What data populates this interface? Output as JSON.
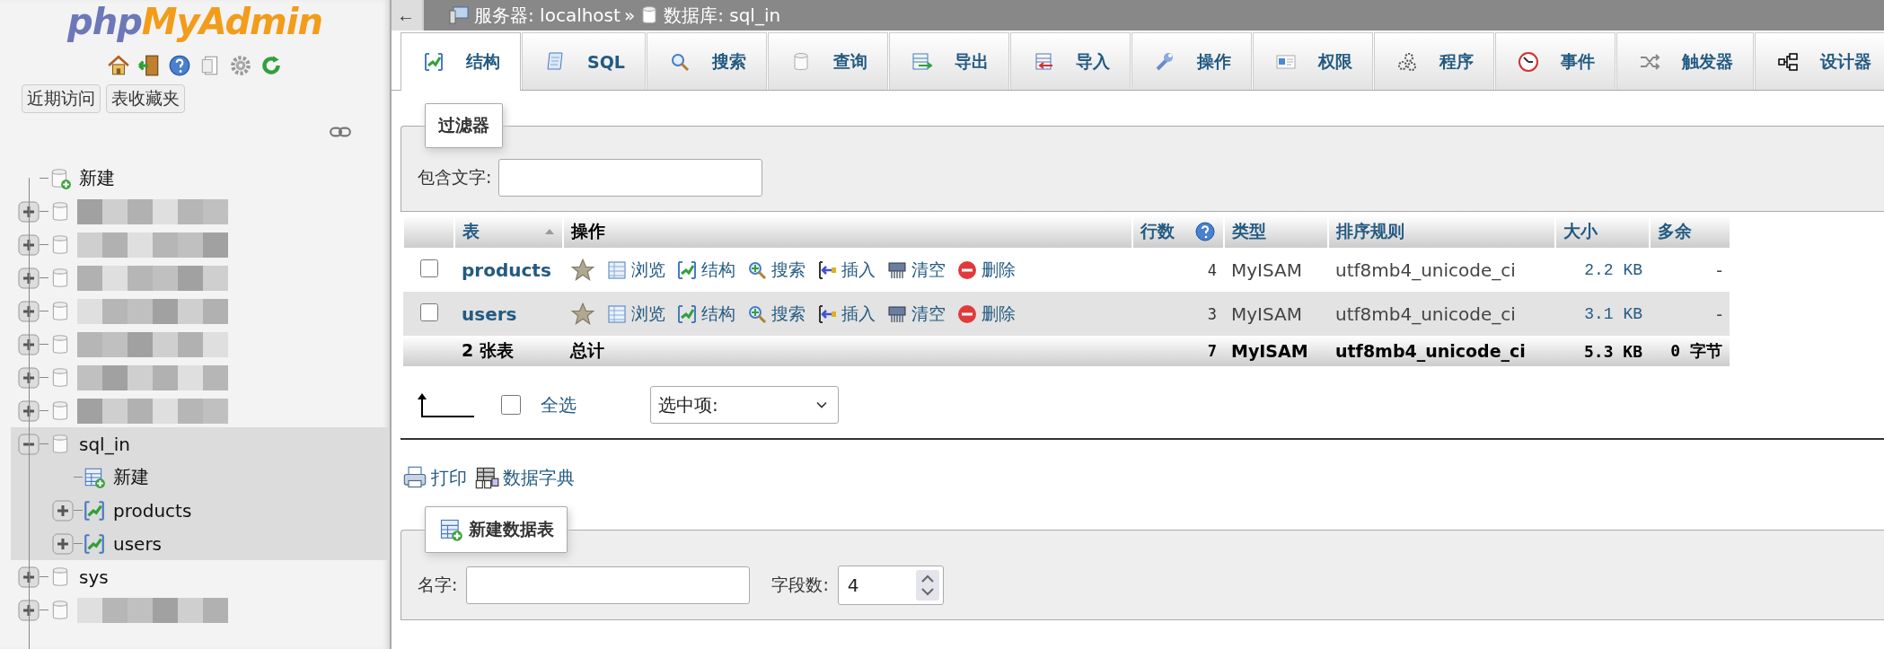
{
  "logo": {
    "part1": "php",
    "part2": "MyAdmin"
  },
  "sidebar_icons": [
    {
      "kind": "home"
    },
    {
      "kind": "exit"
    },
    {
      "kind": "help"
    },
    {
      "kind": "docs"
    },
    {
      "kind": "settings"
    },
    {
      "kind": "reload"
    }
  ],
  "sidebar_buttons": [
    "近期访问",
    "表收藏夹"
  ],
  "tree": [
    {
      "kind": "new",
      "label": "新建"
    },
    {
      "kind": "redacted",
      "expanded": false
    },
    {
      "kind": "redacted",
      "expanded": false
    },
    {
      "kind": "redacted",
      "expanded": false
    },
    {
      "kind": "redacted",
      "expanded": false
    },
    {
      "kind": "redacted",
      "expanded": false
    },
    {
      "kind": "redacted",
      "expanded": false
    },
    {
      "kind": "redacted",
      "expanded": false
    },
    {
      "kind": "database",
      "label": "sql_in",
      "expanded": true,
      "selected": true,
      "children": [
        {
          "kind": "new-table",
          "label": "新建"
        },
        {
          "kind": "table",
          "label": "products",
          "expanded": false
        },
        {
          "kind": "table",
          "label": "users",
          "expanded": false
        }
      ]
    },
    {
      "kind": "database",
      "label": "sys",
      "expanded": false,
      "selected": false
    },
    {
      "kind": "redacted",
      "expanded": false
    }
  ],
  "back_button": "←",
  "breadcrumb": {
    "server": "服务器: localhost",
    "separator": "»",
    "database": "数据库: sql_in"
  },
  "tabs": [
    {
      "kind": "structure",
      "label": "结构",
      "selected": true
    },
    {
      "kind": "sql",
      "label": "SQL",
      "selected": false
    },
    {
      "kind": "search",
      "label": "搜索",
      "selected": false
    },
    {
      "kind": "query",
      "label": "查询",
      "selected": false
    },
    {
      "kind": "export",
      "label": "导出",
      "selected": false
    },
    {
      "kind": "import",
      "label": "导入",
      "selected": false
    },
    {
      "kind": "operations",
      "label": "操作",
      "selected": false
    },
    {
      "kind": "privileges",
      "label": "权限",
      "selected": false
    },
    {
      "kind": "routines",
      "label": "程序",
      "selected": false
    },
    {
      "kind": "events",
      "label": "事件",
      "selected": false
    },
    {
      "kind": "triggers",
      "label": "触发器",
      "selected": false
    },
    {
      "kind": "designer",
      "label": "设计器",
      "selected": false
    }
  ],
  "filter": {
    "legend": "过滤器",
    "label": "包含文字:"
  },
  "table": {
    "columns": [
      {
        "label": "表",
        "kind": "link",
        "sort_ascending": true
      },
      {
        "label": "操作",
        "kind": "text"
      },
      {
        "label": "行数",
        "kind": "link",
        "help": true
      },
      {
        "label": "类型",
        "kind": "link"
      },
      {
        "label": "排序规则",
        "kind": "link"
      },
      {
        "label": "大小",
        "kind": "link"
      },
      {
        "label": "多余",
        "kind": "link"
      }
    ],
    "rows": [
      {
        "checked": false,
        "name": "products",
        "favorite": false,
        "actions": [
          {
            "kind": "browse",
            "label": "浏览"
          },
          {
            "kind": "structure",
            "label": "结构"
          },
          {
            "kind": "search",
            "label": "搜索"
          },
          {
            "kind": "insert",
            "label": "插入"
          },
          {
            "kind": "empty",
            "label": "清空"
          },
          {
            "kind": "drop",
            "label": "删除"
          }
        ],
        "rows": "4",
        "type": "MyISAM",
        "collation": "utf8mb4_unicode_ci",
        "size": "2.2 KB",
        "overhead": "-"
      },
      {
        "checked": false,
        "name": "users",
        "favorite": false,
        "actions": [
          {
            "kind": "browse",
            "label": "浏览"
          },
          {
            "kind": "structure",
            "label": "结构"
          },
          {
            "kind": "search",
            "label": "搜索"
          },
          {
            "kind": "insert",
            "label": "插入"
          },
          {
            "kind": "empty",
            "label": "清空"
          },
          {
            "kind": "drop",
            "label": "删除"
          }
        ],
        "rows": "3",
        "type": "MyISAM",
        "collation": "utf8mb4_unicode_ci",
        "size": "3.1 KB",
        "overhead": "-"
      }
    ],
    "footer": {
      "count": "2 张表",
      "label": "总计",
      "rows": "7",
      "type": "MyISAM",
      "collation": "utf8mb4_unicode_ci",
      "size": "5.3 KB",
      "overhead": "0 字节"
    }
  },
  "bulk": {
    "checked": false,
    "select_all": "全选",
    "dropdown": "选中项:"
  },
  "links": [
    {
      "kind": "print",
      "label": "打印"
    },
    {
      "kind": "dictionary",
      "label": "数据字典"
    }
  ],
  "create": {
    "legend": "新建数据表",
    "name_label": "名字:",
    "fields_label": "字段数:",
    "fields_value": "4"
  }
}
